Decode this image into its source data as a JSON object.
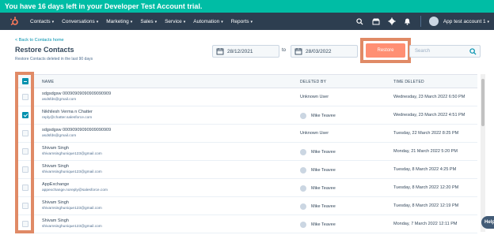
{
  "banner": {
    "text": "You have 16 days left in your Developer Test Account trial."
  },
  "nav": {
    "items": [
      {
        "label": "Contacts"
      },
      {
        "label": "Conversations"
      },
      {
        "label": "Marketing"
      },
      {
        "label": "Sales"
      },
      {
        "label": "Service"
      },
      {
        "label": "Automation"
      },
      {
        "label": "Reports"
      }
    ],
    "account": "App test account 1"
  },
  "page": {
    "back_link": "< Back to Contacts home",
    "title": "Restore Contacts",
    "subtitle": "Restore Contacts deleted in the last 90 days"
  },
  "filters": {
    "from_date": "28/12/2021",
    "to_label": "to",
    "to_date": "28/03/2022",
    "restore_label": "Restore",
    "search_placeholder": "Search"
  },
  "table": {
    "headers": {
      "name": "NAME",
      "deleted_by": "DELETED BY",
      "time_deleted": "TIME DELETED"
    },
    "rows": [
      {
        "name": "sdgsdgsw 00090909090909090909",
        "email": "asdsfds@gmail.com",
        "deleted_by": "Unknown User",
        "time": "Wednesday, 23 March 2022 6:50 PM",
        "checked": false,
        "avatar": false
      },
      {
        "name": "Nikhilesh Verma n Chatter",
        "email": "reply@chatter.salesforce.com",
        "deleted_by": "Mike Teavee",
        "time": "Wednesday, 23 March 2022 4:51 PM",
        "checked": true,
        "avatar": true
      },
      {
        "name": "sdgsdgsw 00090909090909090909",
        "email": "asdsfds@gmail.com",
        "deleted_by": "Unknown User",
        "time": "Tuesday, 22 March 2022 8:25 PM",
        "checked": false,
        "avatar": false
      },
      {
        "name": "Shivam Singh",
        "email": "shivamsinghunique123@gmail.com",
        "deleted_by": "Mike Teavee",
        "time": "Monday, 21 March 2022 5:20 PM",
        "checked": false,
        "avatar": true
      },
      {
        "name": "Shivam Singh",
        "email": "shivamsinghunique123@gmail.com",
        "deleted_by": "Mike Teavee",
        "time": "Tuesday, 8 March 2022 4:25 PM",
        "checked": false,
        "avatar": true
      },
      {
        "name": "AppExchange",
        "email": "appexchange.noreply@salesforce.com",
        "deleted_by": "Mike Teavee",
        "time": "Tuesday, 8 March 2022 12:20 PM",
        "checked": false,
        "avatar": true
      },
      {
        "name": "Shivam Singh",
        "email": "shivamsinghunique123@gmail.com",
        "deleted_by": "Mike Teavee",
        "time": "Tuesday, 8 March 2022 12:19 PM",
        "checked": false,
        "avatar": true
      },
      {
        "name": "Shivam Singh",
        "email": "shivamsinghunique123@gmail.com",
        "deleted_by": "Mike Teavee",
        "time": "Monday, 7 March 2022 12:11 PM",
        "checked": false,
        "avatar": true
      }
    ]
  },
  "help": {
    "label": "Help"
  },
  "colors": {
    "banner": "#00bda5",
    "nav": "#2d3e50",
    "restore": "#ff8f73",
    "highlight": "#e08a66",
    "check": "#0091ae"
  }
}
